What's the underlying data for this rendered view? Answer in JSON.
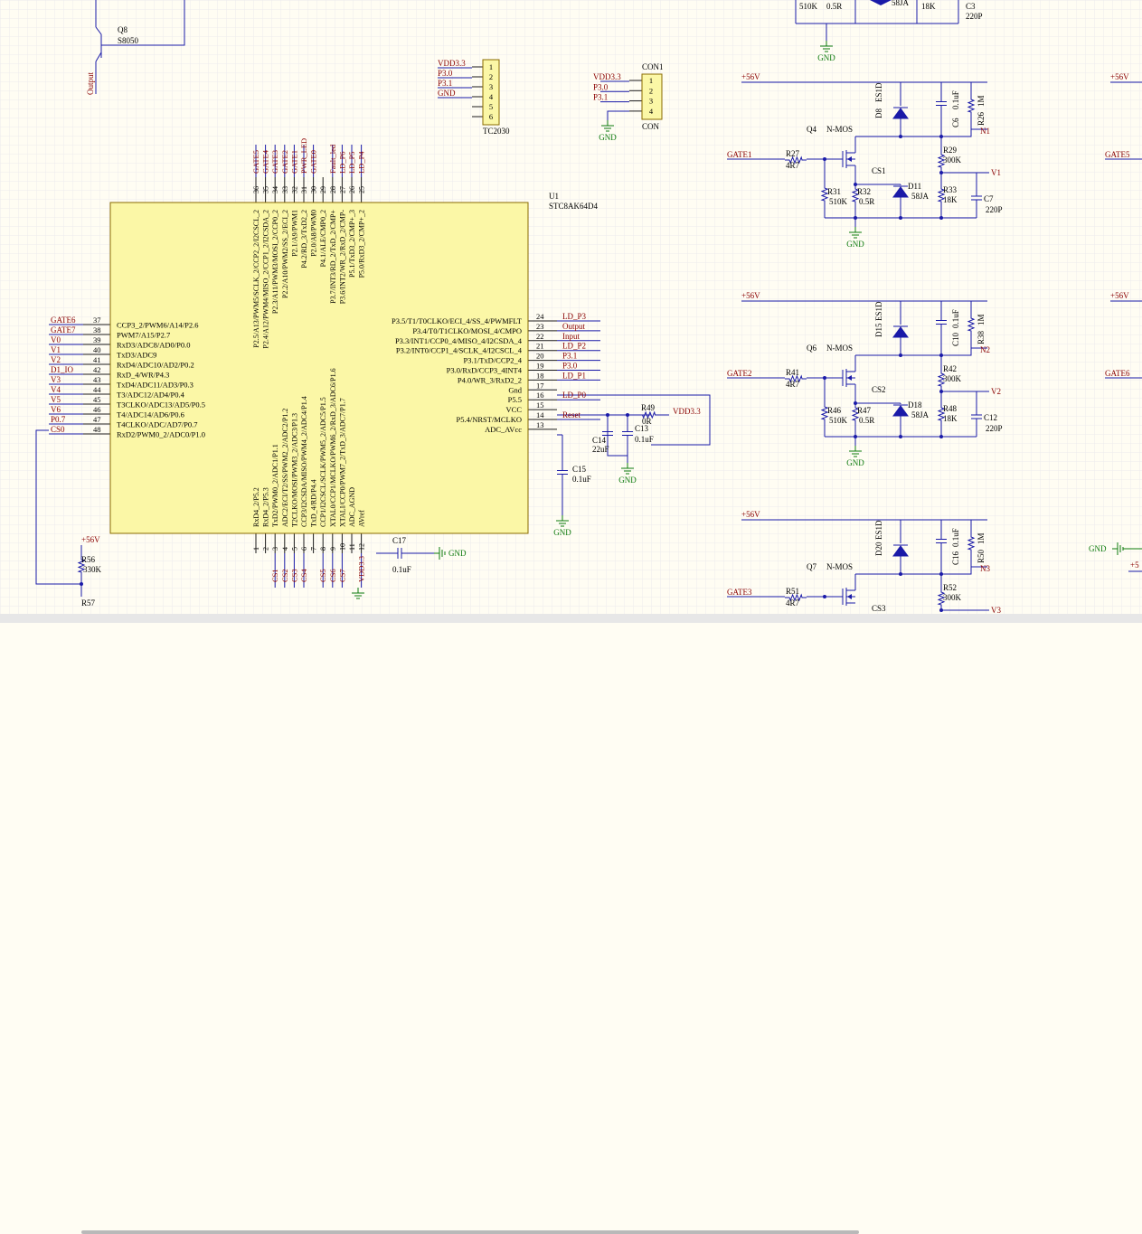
{
  "colors": {
    "wire": "#1a1aa8",
    "net": "#8a0000",
    "label": "#000000",
    "part": "#1a1aa8",
    "chip": "#fbf7a6",
    "gnd": "#0d7a0d",
    "pin": "#1c1c1c",
    "grid": "#eaeaea"
  },
  "chip": {
    "designator": "U1",
    "part": "STC8AK64D4",
    "left_pins": [
      {
        "num": "37",
        "name": "CCP3_2/PWM6/A14/P2.6",
        "net": "GATE6"
      },
      {
        "num": "38",
        "name": "PWM7/A15/P2.7",
        "net": "GATE7"
      },
      {
        "num": "39",
        "name": "RxD3/ADC8/AD0/P0.0",
        "net": "V0"
      },
      {
        "num": "40",
        "name": "TxD3/ADC9",
        "net": "V1"
      },
      {
        "num": "41",
        "name": "RxD4/ADC10/AD2/P0.2",
        "net": "V2"
      },
      {
        "num": "42",
        "name": "RxD_4/WR/P4.3",
        "net": "D1_IO"
      },
      {
        "num": "43",
        "name": "TxD4/ADC11/AD3/P0.3",
        "net": "V3"
      },
      {
        "num": "44",
        "name": "T3/ADC12/AD4/P0.4",
        "net": "V4"
      },
      {
        "num": "45",
        "name": "T3CLKO/ADC13/AD5/P0.5",
        "net": "V5"
      },
      {
        "num": "46",
        "name": "T4/ADC14/AD6/P0.6",
        "net": "V6"
      },
      {
        "num": "47",
        "name": "T4CLKO/ADC/AD7/P0.7",
        "net": "P0.7"
      },
      {
        "num": "48",
        "name": "RxD2/PWM0_2/ADC0/P1.0",
        "net": "CS0"
      }
    ],
    "right_pins": [
      {
        "num": "24",
        "name": "P3.5/T1/T0CLKO/ECI_4/SS_4/PWMFLT",
        "net": "LD_P3"
      },
      {
        "num": "23",
        "name": "P3.4/T0/T1CLKO/MOSI_4/CMPO",
        "net": "Output"
      },
      {
        "num": "22",
        "name": "P3.3/INT1/CCP0_4/MISO_4/I2CSDA_4",
        "net": "Input"
      },
      {
        "num": "21",
        "name": "P3.2/INT0/CCP1_4/SCLK_4/I2CSCL_4",
        "net": "LD_P2"
      },
      {
        "num": "20",
        "name": "P3.1/TxD/CCP2_4",
        "net": "P3.1"
      },
      {
        "num": "19",
        "name": "P3.0/RxD/CCP3_4INT4",
        "net": "P3.0"
      },
      {
        "num": "18",
        "name": "P4.0/WR_3/RxD2_2",
        "net": "LD_P1"
      },
      {
        "num": "17",
        "name": "Gnd",
        "net": ""
      },
      {
        "num": "16",
        "name": "P5.5",
        "net": "LD_P0"
      },
      {
        "num": "15",
        "name": "VCC",
        "net": ""
      },
      {
        "num": "14",
        "name": "P5.4/NRST/MCLKO",
        "net": "Reset"
      },
      {
        "num": "13",
        "name": "ADC_AVcc",
        "net": ""
      }
    ],
    "top_pins": [
      {
        "num": "36",
        "name": "P2.5/A13/PWM5/SCLK_2/CCP2_2/I2CSCL_2",
        "net": "GATE5"
      },
      {
        "num": "35",
        "name": "P2.4/A12/PWM4/MISO_2/CCP1_2/I2CSDA_2",
        "net": "GATE4"
      },
      {
        "num": "34",
        "name": "P2.3/A11/PWM3/MOSI_2/CCP0_2",
        "net": "GATE3"
      },
      {
        "num": "33",
        "name": "P2.2/A10/PWM2/SS_2/ECI_2",
        "net": "GATE2"
      },
      {
        "num": "32",
        "name": "P2.1/A9/PWM1",
        "net": "GATE1"
      },
      {
        "num": "31",
        "name": "P4.2/RD_3/TxD2_2",
        "net": "PWR_LED"
      },
      {
        "num": "30",
        "name": "P2.0/A8/PWM0",
        "net": "GATE0"
      },
      {
        "num": "29",
        "name": "P4.1/ALE/CMP0_2",
        "net": ""
      },
      {
        "num": "28",
        "name": "P3.7/INT3/RD_2/TxD_2/CMP+",
        "net": "Fault_led"
      },
      {
        "num": "27",
        "name": "P3.6/INT2/WR_2/RxD_2/CMP-",
        "net": "LD_P6"
      },
      {
        "num": "26",
        "name": "P5.1/TxD3_2/CMP+_3",
        "net": "LD_P5"
      },
      {
        "num": "25",
        "name": "P5.0/RxD3_2/CMP+_2",
        "net": "LD_P4"
      }
    ],
    "bottom_pins": [
      {
        "num": "1",
        "name": "RxD4_2/P5.2",
        "net": ""
      },
      {
        "num": "2",
        "name": "RxD4_2/P5.3",
        "net": ""
      },
      {
        "num": "3",
        "name": "TxD2/PWM0_2/ADC1/P1.1",
        "net": "CS1"
      },
      {
        "num": "4",
        "name": "ADC2/ECI/T2/SS/PWM2_2/ADC2/P1.2",
        "net": "CS2"
      },
      {
        "num": "5",
        "name": "T2CLKO/MOSI/PWM3_2/ADC3/P1.3",
        "net": "CS3"
      },
      {
        "num": "6",
        "name": "CCP3/I2CSDA/MISO/PWM4_2/ADC4/P1.4",
        "net": "CS4"
      },
      {
        "num": "7",
        "name": "TxD_4/RD/P4.4",
        "net": ""
      },
      {
        "num": "8",
        "name": "CCP1/I2CSCL/SCLK/PWM5_2/ADC5/P1.5",
        "net": "CS5"
      },
      {
        "num": "9",
        "name": "XTAL0/CCP1/MCLKO/PWM6_2/RxD_3/ADC6/P1.6",
        "net": "CS6"
      },
      {
        "num": "10",
        "name": "XTALI/CCP0/PWM7_2/TxD_3/ADC7/P1.7",
        "net": "CS7"
      },
      {
        "num": "11",
        "name": "ADC_AGND",
        "net": ""
      },
      {
        "num": "12",
        "name": "AVref",
        "net": "VDD3.3"
      }
    ]
  },
  "connectors": [
    {
      "name": "TC2030",
      "labels": [
        "VDD3.3",
        "P3.0",
        "P3.1",
        "GND",
        "",
        ""
      ],
      "pins": [
        "1",
        "2",
        "3",
        "4",
        "5",
        "6"
      ]
    },
    {
      "name": "CON",
      "designator": "CON1",
      "labels": [
        "VDD3.3",
        "P3.0",
        "P3.1",
        ""
      ],
      "pins": [
        "1",
        "2",
        "3",
        "4"
      ],
      "gnd": "GND"
    }
  ],
  "top_left": {
    "q": "Q8",
    "q_part": "S8050",
    "net": "Output"
  },
  "top_partial": {
    "r1": "510K",
    "r2": "0.5R",
    "d": "58JA",
    "r3": "18K",
    "c": "C3",
    "c_val": "220P",
    "gnd": "GND"
  },
  "supply": "+56V",
  "mosfets": [
    {
      "q": "Q4",
      "type": "N-MOS",
      "gate": "GATE1",
      "rg": "R27",
      "rg_val": "4R7",
      "cs": "CS1",
      "d_top": "D8",
      "d_top_part": "ES1D",
      "c_top": "C6",
      "c_top_val": "0.1uF",
      "r_top": "R26",
      "r_top_val": "1M",
      "node": "N1",
      "r_mid": "R29",
      "r_mid_val": "300K",
      "v": "V1",
      "rpd": "R31",
      "rpd_val": "510K",
      "rs": "R32",
      "rs_val": "0.5R",
      "d_bot": "D11",
      "d_bot_part": "58JA",
      "r_bot": "R33",
      "r_bot_val": "18K",
      "c_bot": "C7",
      "c_bot_val": "220P",
      "gnd": "GND",
      "right_gate": "GATE5"
    },
    {
      "q": "Q6",
      "type": "N-MOS",
      "gate": "GATE2",
      "rg": "R41",
      "rg_val": "4R7",
      "cs": "CS2",
      "d_top": "D15",
      "d_top_part": "ES1D",
      "c_top": "C10",
      "c_top_val": "0.1uF",
      "r_top": "R38",
      "r_top_val": "1M",
      "node": "N2",
      "r_mid": "R42",
      "r_mid_val": "300K",
      "v": "V2",
      "rpd": "R46",
      "rpd_val": "510K",
      "rs": "R47",
      "rs_val": "0.5R",
      "d_bot": "D18",
      "d_bot_part": "58JA",
      "r_bot": "R48",
      "r_bot_val": "18K",
      "c_bot": "C12",
      "c_bot_val": "220P",
      "gnd": "GND",
      "right_gate": "GATE6"
    },
    {
      "q": "Q7",
      "type": "N-MOS",
      "gate": "GATE3",
      "rg": "R51",
      "rg_val": "4R7",
      "cs": "CS3",
      "d_top": "D20",
      "d_top_part": "ES1D",
      "c_top": "C16",
      "c_top_val": "0.1uF",
      "r_top": "R50",
      "r_top_val": "1M",
      "node": "N3",
      "r_mid": "R52",
      "r_mid_val": "300K",
      "v": "V3",
      "rpd": "",
      "rpd_val": "",
      "rs": "",
      "rs_val": "",
      "d_bot": "",
      "d_bot_part": "",
      "r_bot": "",
      "r_bot_val": "",
      "c_bot": "",
      "c_bot_val": "",
      "gnd": "",
      "right_gate": ""
    }
  ],
  "power": {
    "r49": "R49",
    "r49_val": "0R",
    "vdd": "VDD3.3",
    "c14": "C14",
    "c14_val": "22uF",
    "c13": "C13",
    "c13_val": "0.1uF",
    "c15": "C15",
    "c15_val": "0.1uF",
    "gnd": "GND",
    "c17": "C17",
    "c17_val": "0.1uF",
    "gnd2": "GND"
  },
  "bottom_left": {
    "supply": "+56V",
    "r56": "R56",
    "r56_val": "330K",
    "r57": "R57"
  },
  "far_right": {
    "gnd": "GND",
    "supply": "+5"
  }
}
